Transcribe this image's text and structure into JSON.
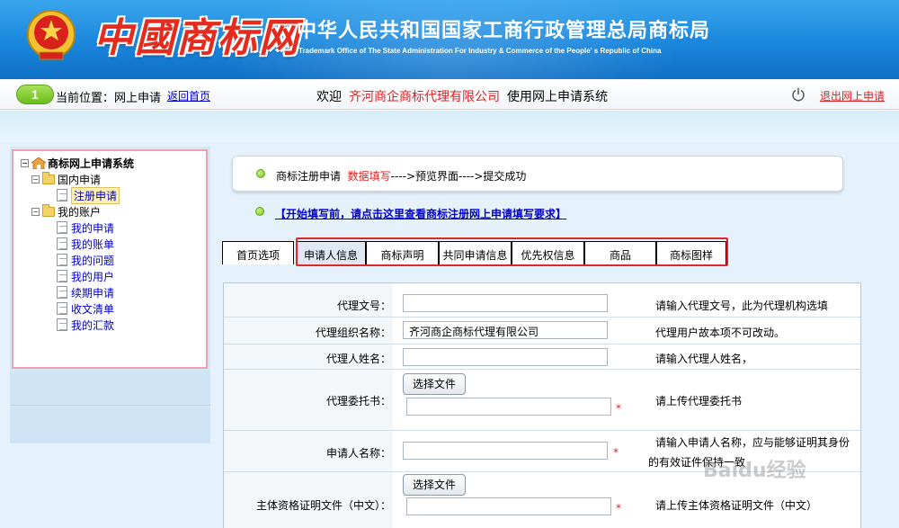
{
  "header": {
    "logo_text": "中國商标网",
    "org_cn": "中华人民共和国国家工商行政管理总局商标局",
    "org_en": "Trademark Office of The State Administration For Industry & Commerce of the People' s Republic of China"
  },
  "navbar": {
    "location_label": "当前位置：网上申请",
    "back_home": "返回首页",
    "welcome_prefix": "欢迎",
    "company": "齐河商企商标代理有限公司",
    "welcome_suffix": "使用网上申请系统",
    "logout": "退出网上申请"
  },
  "sidebar": {
    "root": "商标网上申请系统",
    "domestic": "国内申请",
    "register": "注册申请",
    "account": "我的账户",
    "items": [
      "我的申请",
      "我的账单",
      "我的问题",
      "我的用户",
      "续期申请",
      "收文清单",
      "我的汇款"
    ]
  },
  "steps": {
    "step1": "商标注册申请",
    "step2": "数据填写",
    "rest": "---->预览界面---->提交成功"
  },
  "notice": "【开始填写前，请点击这里查看商标注册网上申请填写要求】",
  "tabs": [
    "首页选项",
    "申请人信息",
    "商标声明",
    "共同申请信息",
    "优先权信息",
    "商品",
    "商标图样"
  ],
  "form": {
    "agent_no_label": "代理文号：",
    "agent_no_value": "",
    "agent_no_hint": "请输入代理文号，此为代理机构选填",
    "agent_org_label": "代理组织名称：",
    "agent_org_value": "齐河商企商标代理有限公司",
    "agent_org_hint": "代理用户故本项不可改动。",
    "agent_name_label": "代理人姓名：",
    "agent_name_value": "",
    "agent_name_hint": "请输入代理人姓名，",
    "power_label": "代理委托书：",
    "choose_file": "选择文件",
    "power_hint": "请上传代理委托书",
    "applicant_label": "申请人名称：",
    "applicant_value": "",
    "applicant_hint_1": "请输入申请人名称，应与能够证明其身份",
    "applicant_hint_2": "的有效证件保持一致",
    "cert_label": "主体资格证明文件（中文）：",
    "cert_hint": "请上传主体资格证明文件（中文）",
    "required_mark": "*"
  },
  "watermark": "Baidu经验",
  "colors": {
    "header_blue": "#1a86dc",
    "accent_red": "#e02020",
    "link_blue": "#0000cc",
    "highlight_red": "#e0262b"
  }
}
